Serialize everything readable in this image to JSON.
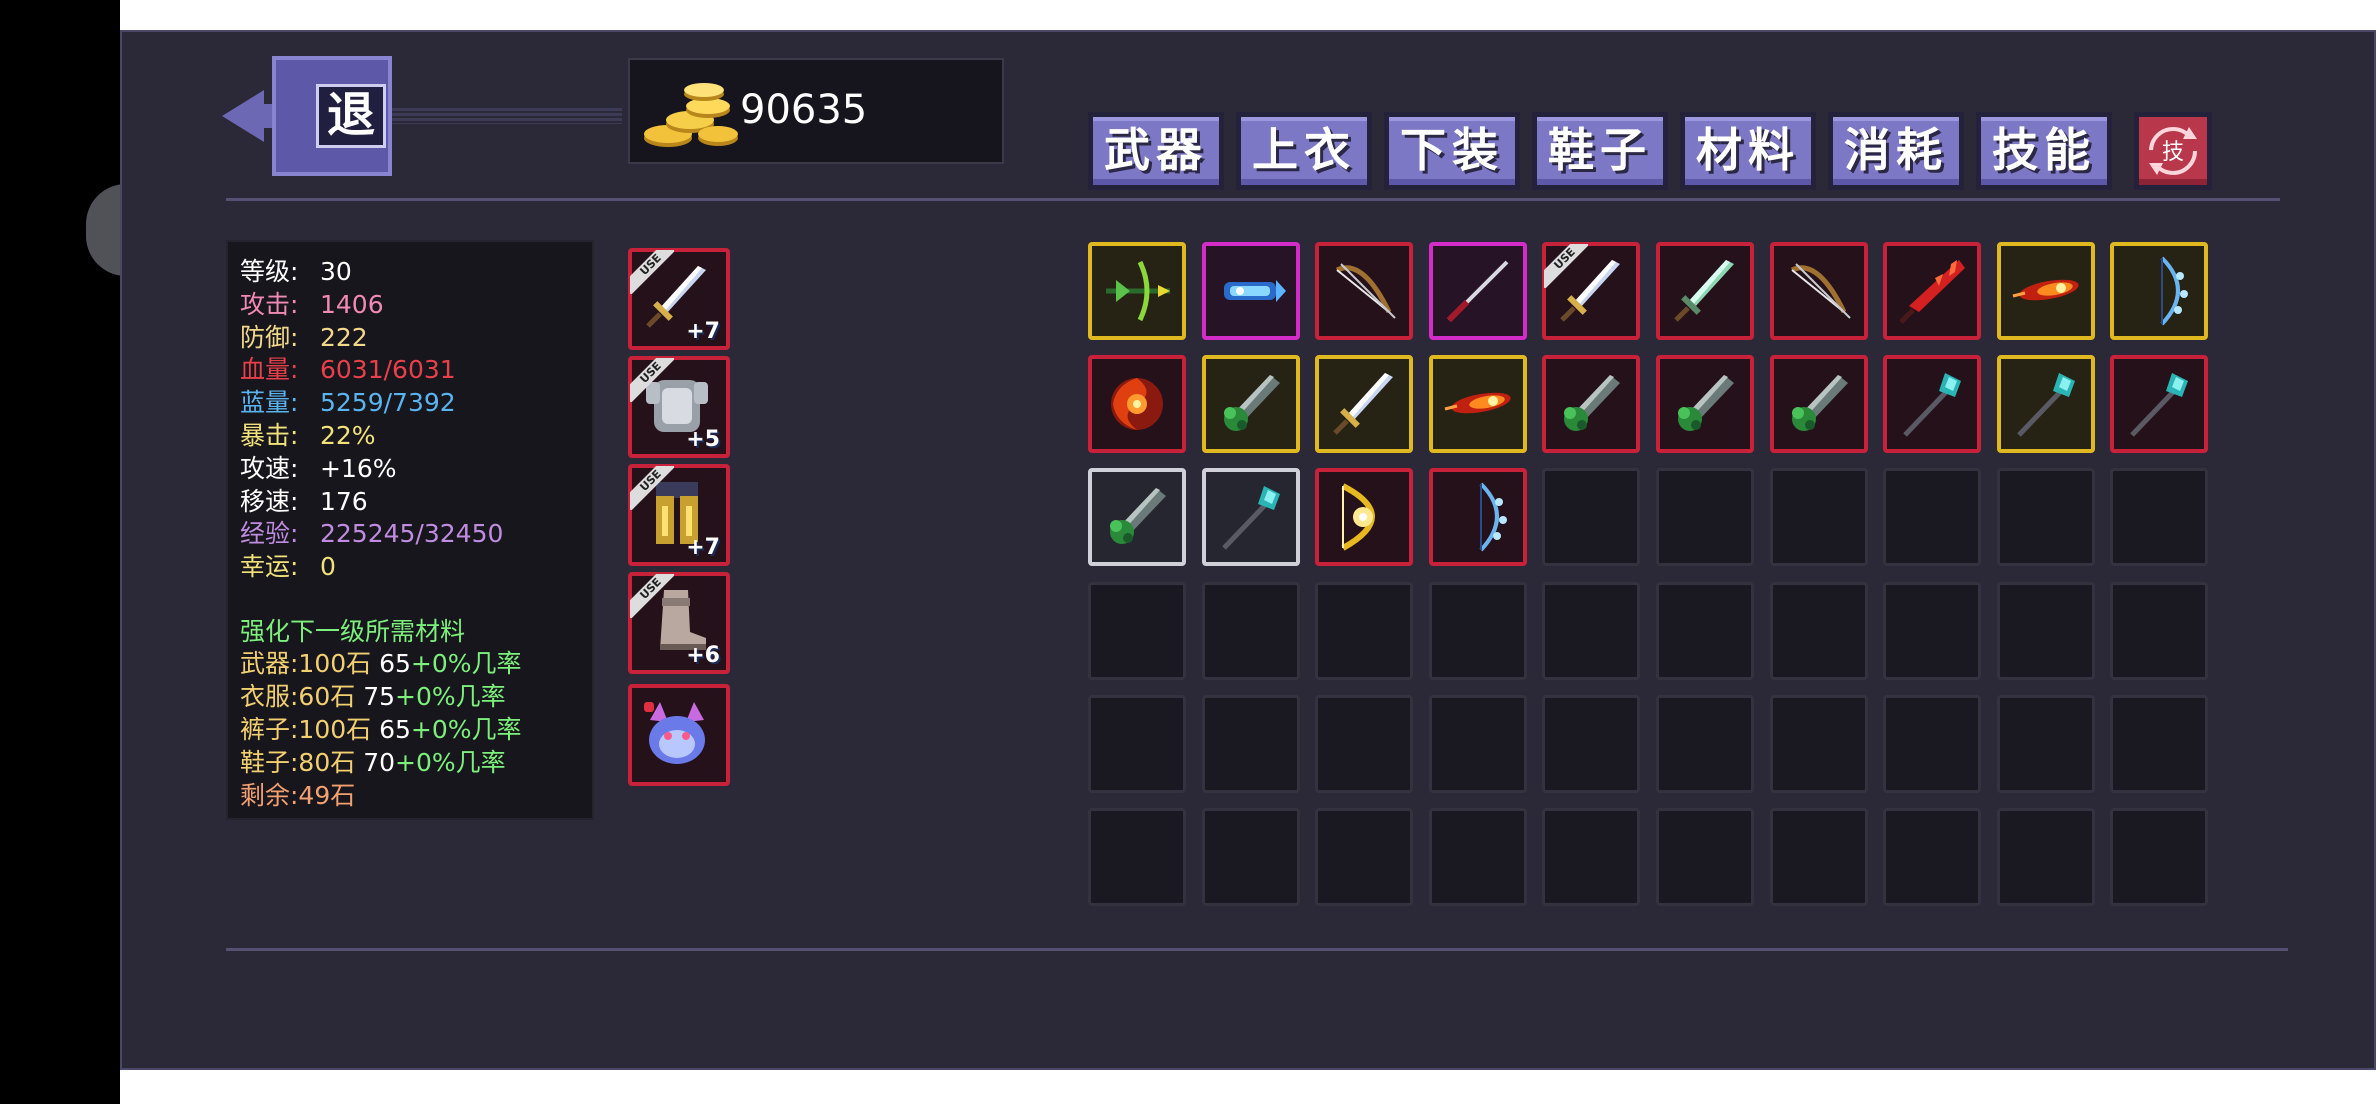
{
  "gold": {
    "amount": "90635"
  },
  "back_button": {
    "label": "退"
  },
  "tabs": [
    {
      "label": "武器"
    },
    {
      "label": "上衣"
    },
    {
      "label": "下装"
    },
    {
      "label": "鞋子"
    },
    {
      "label": "材料"
    },
    {
      "label": "消耗"
    },
    {
      "label": "技能"
    }
  ],
  "skill_swap": {
    "label": "技"
  },
  "stats": [
    {
      "key": "等级:",
      "value": "30",
      "color": "#ffffff"
    },
    {
      "key": "攻击:",
      "value": "1406",
      "color": "#f08ab4"
    },
    {
      "key": "防御:",
      "value": "222",
      "color": "#f2d88a"
    },
    {
      "key": "血量:",
      "value": "6031/6031",
      "color": "#e8404a"
    },
    {
      "key": "蓝量:",
      "value": "5259/7392",
      "color": "#5ab4f0"
    },
    {
      "key": "暴击:",
      "value": "22%",
      "color": "#f2e27a"
    },
    {
      "key": "攻速:",
      "value": "+16%",
      "color": "#ffffff"
    },
    {
      "key": "移速:",
      "value": "176",
      "color": "#ffffff"
    },
    {
      "key": "经验:",
      "value": "225245/32450",
      "color": "#c08ce0"
    },
    {
      "key": "幸运:",
      "value": "0",
      "color": "#f2e27a"
    }
  ],
  "enhance": {
    "title": "强化下一级所需材料",
    "rows": [
      {
        "label": "武器:100石",
        "chance": "65",
        "bonus": "+0%几率"
      },
      {
        "label": "衣服:60石",
        "chance": "75",
        "bonus": "+0%几率"
      },
      {
        "label": "裤子:100石",
        "chance": "65",
        "bonus": "+0%几率"
      },
      {
        "label": "鞋子:80石",
        "chance": "70",
        "bonus": "+0%几率"
      }
    ],
    "remaining": "剩余:49石"
  },
  "equipped": [
    {
      "slot": "weapon",
      "icon": "sword-icon",
      "tag": "USE",
      "level": "+7"
    },
    {
      "slot": "armor",
      "icon": "chestplate-icon",
      "tag": "USE",
      "level": "+5"
    },
    {
      "slot": "pants",
      "icon": "leggings-icon",
      "tag": "USE",
      "level": "+7"
    },
    {
      "slot": "boots",
      "icon": "boots-icon",
      "tag": "USE",
      "level": "+6"
    },
    {
      "slot": "pet",
      "icon": "pet-icon"
    }
  ],
  "inventory": [
    {
      "icon": "crossbow-icon",
      "rarity": "gold"
    },
    {
      "icon": "ice-blaster-icon",
      "rarity": "pink"
    },
    {
      "icon": "bow-icon",
      "rarity": "red"
    },
    {
      "icon": "katana-icon",
      "rarity": "pink"
    },
    {
      "icon": "sword-icon",
      "rarity": "red",
      "tag": "USE"
    },
    {
      "icon": "jade-sword-icon",
      "rarity": "red"
    },
    {
      "icon": "bow-icon",
      "rarity": "red"
    },
    {
      "icon": "flame-sword-icon",
      "rarity": "red"
    },
    {
      "icon": "fire-staff-icon",
      "rarity": "gold"
    },
    {
      "icon": "ice-bow-icon",
      "rarity": "gold"
    },
    {
      "icon": "fire-shuriken-icon",
      "rarity": "red"
    },
    {
      "icon": "poison-sword-icon",
      "rarity": "gold"
    },
    {
      "icon": "sword-icon",
      "rarity": "gold"
    },
    {
      "icon": "fire-staff-icon",
      "rarity": "gold"
    },
    {
      "icon": "poison-sword-icon",
      "rarity": "red"
    },
    {
      "icon": "poison-sword-icon",
      "rarity": "red"
    },
    {
      "icon": "poison-sword-icon",
      "rarity": "red"
    },
    {
      "icon": "crystal-staff-icon",
      "rarity": "red"
    },
    {
      "icon": "crystal-staff-icon",
      "rarity": "gold"
    },
    {
      "icon": "crystal-staff-icon",
      "rarity": "red"
    },
    {
      "icon": "poison-sword-icon",
      "rarity": "white"
    },
    {
      "icon": "crystal-staff-icon",
      "rarity": "white"
    },
    {
      "icon": "golden-bow-icon",
      "rarity": "red"
    },
    {
      "icon": "ice-bow-icon",
      "rarity": "red"
    }
  ],
  "inventory_capacity": 60,
  "colors": {
    "background": "#2b2837",
    "tab": "#7d78c6",
    "gold_rarity": "#e0b820",
    "red_rarity": "#c8213a",
    "pink_rarity": "#d42cc8",
    "white_rarity": "#d0d0d8",
    "enhance_title": "#7cf07a",
    "enhance_label": "#f2d070",
    "remaining": "#f2a070"
  }
}
